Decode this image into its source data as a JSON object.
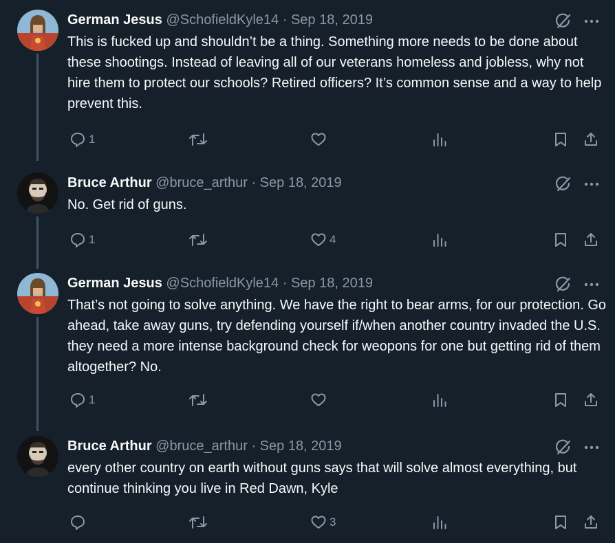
{
  "tweets": [
    {
      "name": "German Jesus",
      "handle": "@SchofieldKyle14",
      "date": "Sep 18, 2019",
      "text": "This is fucked up and shouldn’t be a thing. Something more needs to be done about these shootings. Instead of leaving all of our veterans homeless and jobless, why not hire them to protect our schools? Retired officers? It’s common sense and a way to help prevent this.",
      "replies": "1",
      "retweets": "",
      "likes": "",
      "avatar": "religious-portrait-avatar"
    },
    {
      "name": "Bruce Arthur",
      "handle": "@bruce_arthur",
      "date": "Sep 18, 2019",
      "text": "No. Get rid of guns.",
      "replies": "1",
      "retweets": "",
      "likes": "4",
      "avatar": "bearded-man-avatar"
    },
    {
      "name": "German Jesus",
      "handle": "@SchofieldKyle14",
      "date": "Sep 18, 2019",
      "text": "That’s not going to solve anything. We have the right to bear arms, for our protection. Go ahead, take away guns, try defending yourself if/when another country invaded the U.S. they need a more intense background check for weopons for one but getting rid of them altogether? No.",
      "replies": "1",
      "retweets": "",
      "likes": "",
      "avatar": "religious-portrait-avatar"
    },
    {
      "name": "Bruce Arthur",
      "handle": "@bruce_arthur",
      "date": "Sep 18, 2019",
      "text": "every other country on earth without guns says that will solve almost everything, but continue thinking you live in Red Dawn, Kyle",
      "replies": "",
      "retweets": "",
      "likes": "3",
      "avatar": "bearded-man-avatar"
    }
  ],
  "separator": "·",
  "colors": {
    "background": "#15202b",
    "text": "#f7f9f9",
    "muted": "#8b98a5",
    "thread_line": "#3d5466"
  }
}
